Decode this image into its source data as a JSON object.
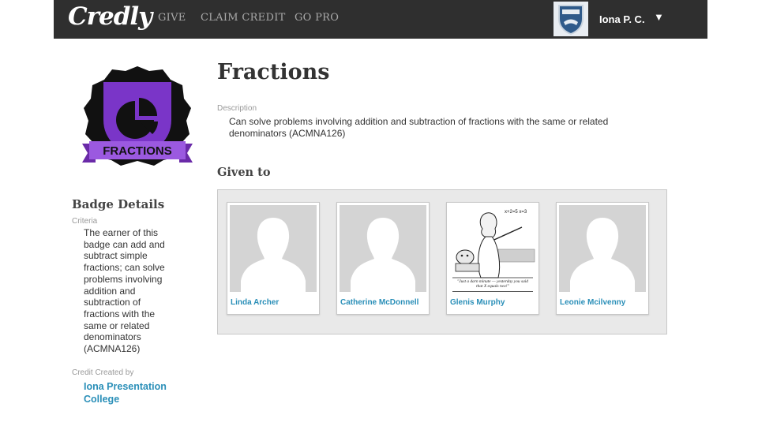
{
  "nav": {
    "logo": "Credly",
    "links": [
      "GIVE",
      "CLAIM CREDIT",
      "GO PRO"
    ],
    "user_name": "Iona P. C.",
    "caret": "▼"
  },
  "badge": {
    "ribbon_text": "FRACTIONS",
    "colors": {
      "outer": "#111111",
      "shield": "#7a35c8",
      "ribbon": "#9b59e0",
      "ribbon_dark": "#6a2aa8"
    }
  },
  "badge_details": {
    "title": "Badge Details",
    "criteria_label": "Criteria",
    "criteria_text": "The earner of this badge can add and subtract simple fractions; can solve problems involving addition and subtraction of fractions with the same or related denominators (ACMNA126)",
    "created_label": "Credit Created by",
    "created_by": "Iona Presentation College"
  },
  "main": {
    "title": "Fractions",
    "description_label": "Description",
    "description": "Can solve problems involving addition and subtraction of fractions with the same or related denominators (ACMNA126)",
    "given_to_label": "Given to",
    "recipients": [
      {
        "name": "Linda Archer",
        "avatar": "default-silhouette"
      },
      {
        "name": "Catherine McDonnell",
        "avatar": "default-silhouette"
      },
      {
        "name": "Glenis Murphy",
        "avatar": "cartoon"
      },
      {
        "name": "Leonie Mcilvenny",
        "avatar": "default-silhouette"
      }
    ],
    "cartoon_caption": "\"Just a darn minute — yesterday you said that X equals two!\"",
    "cartoon_board_text": "x+2=5   x=3"
  },
  "colors": {
    "topbar": "#2f2f2f",
    "link": "#2a8fb8",
    "panel": "#e9e9e9"
  }
}
